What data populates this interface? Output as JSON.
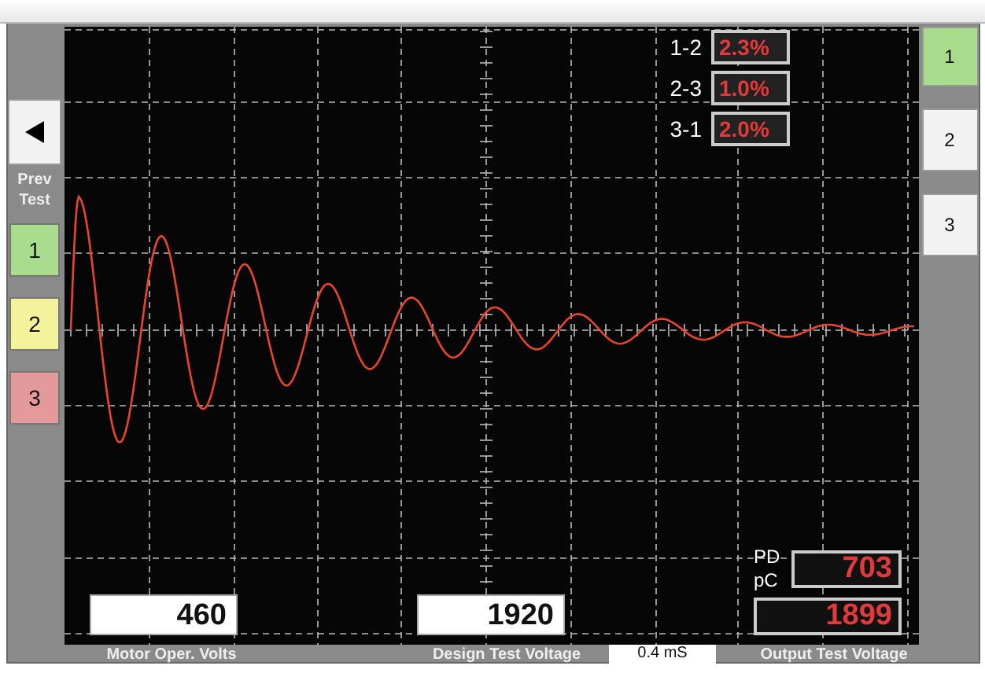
{
  "prev_test": {
    "label": "Prev Test"
  },
  "prev_tests": [
    {
      "label": "1",
      "color": "#a9dc8c"
    },
    {
      "label": "2",
      "color": "#f4f29a"
    },
    {
      "label": "3",
      "color": "#e49a9a"
    }
  ],
  "phase_buttons": [
    {
      "label": "1",
      "selected": true
    },
    {
      "label": "2",
      "selected": false
    },
    {
      "label": "3",
      "selected": false
    }
  ],
  "imbalance": [
    {
      "pair": "1-2",
      "value": "2.3%"
    },
    {
      "pair": "2-3",
      "value": "1.0%"
    },
    {
      "pair": "3-1",
      "value": "2.0%"
    }
  ],
  "pd": {
    "label_top": "PD",
    "label_bottom": "pC",
    "value": "703"
  },
  "fields": [
    {
      "value": "460",
      "label": "Motor Oper. Volts"
    },
    {
      "value": "1920",
      "label": "Design Test Voltage"
    }
  ],
  "time_scale": "0.4 mS",
  "output": {
    "value": "1899",
    "label": "Output Test Voltage"
  }
}
